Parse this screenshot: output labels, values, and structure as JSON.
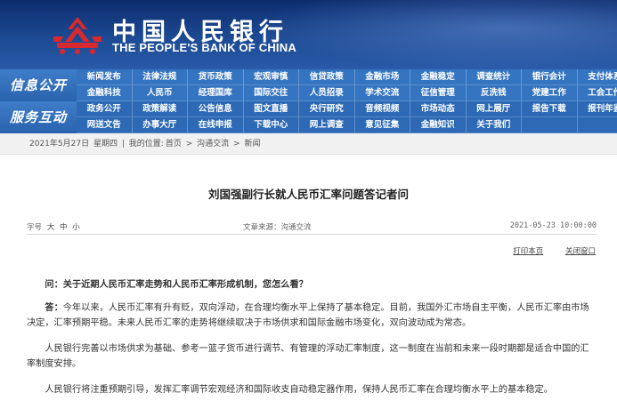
{
  "header": {
    "logo_cn": "中国人民银行",
    "logo_en": "THE PEOPLE'S BANK OF CHINA",
    "brand_red": "#d8292f"
  },
  "nav": {
    "info_label": "信息公开",
    "service_label": "服务互动",
    "info_rows": [
      [
        "新闻发布",
        "法律法规",
        "货币政策",
        "宏观审慎",
        "信贷政策",
        "金融市场",
        "金融稳定",
        "调查统计",
        "银行会计",
        "支付体系"
      ],
      [
        "金融科技",
        "人民币",
        "经理国库",
        "国际交往",
        "人员招录",
        "学术交流",
        "征信管理",
        "反洗钱",
        "党建工作",
        "工会工作"
      ]
    ],
    "service_rows": [
      [
        "政务公开",
        "政策解读",
        "公告信息",
        "图文直播",
        "央行研究",
        "音频视频",
        "市场动态",
        "网上展厅",
        "报告下载",
        "报刊年鉴"
      ],
      [
        "网送文告",
        "办事大厅",
        "在线申报",
        "下载中心",
        "网上调查",
        "意见征集",
        "金融知识",
        "关于我们",
        "",
        ""
      ]
    ]
  },
  "breadcrumb": {
    "date": "2021年5月27日",
    "weekday": "星期四",
    "sep": "|",
    "location_label": "我的位置:",
    "path": [
      "首页",
      "沟通交流",
      "新闻"
    ],
    "arrow": ">"
  },
  "article": {
    "title": "刘国强副行长就人民币汇率问题答记者问",
    "font_size_label": "字号",
    "font_sizes": [
      "大",
      "中",
      "小"
    ],
    "source": "文章来源：沟通交流",
    "date": "2021-05-23 10:00:00",
    "print_label": "打印本页",
    "close_label": "关闭窗口",
    "question": "问：关于近期人民币汇率走势和人民币汇率形成机制，您怎么看？",
    "answer_label": "答：",
    "answer_text": "今年以来，人民币汇率有升有贬，双向浮动，在合理均衡水平上保持了基本稳定。目前，我国外汇市场自主平衡，人民币汇率由市场决定，汇率预期平稳。未来人民币汇率的走势将继续取决于市场供求和国际金融市场变化，双向波动成为常态。",
    "paragraph2": "人民银行完善以市场供求为基础、参考一篮子货币进行调节、有管理的浮动汇率制度，这一制度在当前和未来一段时期都是适合中国的汇率制度安排。",
    "paragraph3": "人民银行将注重预期引导，发挥汇率调节宏观经济和国际收支自动稳定器作用，保持人民币汇率在合理均衡水平上的基本稳定。"
  }
}
